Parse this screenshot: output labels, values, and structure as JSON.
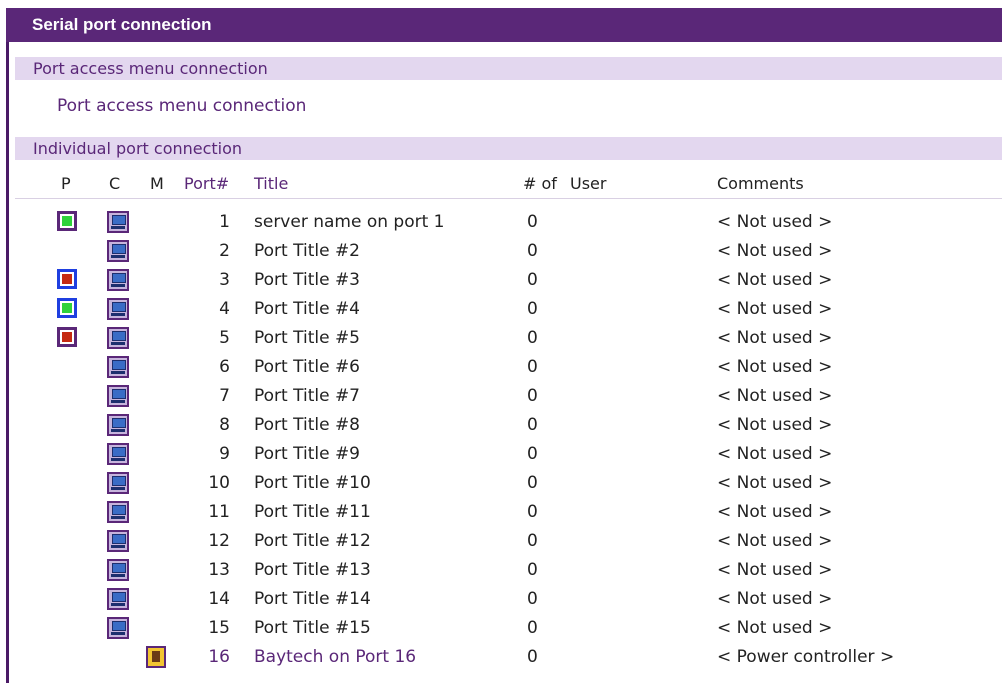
{
  "header": {
    "title": "Serial port connection"
  },
  "sections": {
    "menu": {
      "title": "Port access menu connection",
      "link": "Port access menu connection"
    },
    "individual": {
      "title": "Individual port connection"
    }
  },
  "columns": {
    "p": "P",
    "c": "C",
    "m": "M",
    "port": "Port#",
    "title": "Title",
    "count": "# of",
    "user": "User",
    "comments": "Comments"
  },
  "colors": {
    "accent": "#5a2778",
    "section_bg": "#e3d7ef",
    "power_on": "#2fd23b",
    "power_off": "#c52a12",
    "frame_purple": "#5a2778",
    "frame_blue": "#1f3fe0"
  },
  "ports": [
    {
      "port": "1",
      "title": "server name on port 1",
      "count": "0",
      "user": "",
      "comment": "< Not used >",
      "power": "on",
      "power_frame": "purple",
      "connect": true,
      "menu": false
    },
    {
      "port": "2",
      "title": "Port Title #2",
      "count": "0",
      "user": "",
      "comment": "< Not used >",
      "power": "",
      "power_frame": "",
      "connect": true,
      "menu": false
    },
    {
      "port": "3",
      "title": "Port Title #3",
      "count": "0",
      "user": "",
      "comment": "< Not used >",
      "power": "off",
      "power_frame": "blue",
      "connect": true,
      "menu": false
    },
    {
      "port": "4",
      "title": "Port Title #4",
      "count": "0",
      "user": "",
      "comment": "< Not used >",
      "power": "on",
      "power_frame": "blue",
      "connect": true,
      "menu": false
    },
    {
      "port": "5",
      "title": "Port Title #5",
      "count": "0",
      "user": "",
      "comment": "< Not used >",
      "power": "off",
      "power_frame": "purple",
      "connect": true,
      "menu": false
    },
    {
      "port": "6",
      "title": "Port Title #6",
      "count": "0",
      "user": "",
      "comment": "< Not used >",
      "power": "",
      "power_frame": "",
      "connect": true,
      "menu": false
    },
    {
      "port": "7",
      "title": "Port Title #7",
      "count": "0",
      "user": "",
      "comment": "< Not used >",
      "power": "",
      "power_frame": "",
      "connect": true,
      "menu": false
    },
    {
      "port": "8",
      "title": "Port Title #8",
      "count": "0",
      "user": "",
      "comment": "< Not used >",
      "power": "",
      "power_frame": "",
      "connect": true,
      "menu": false
    },
    {
      "port": "9",
      "title": "Port Title #9",
      "count": "0",
      "user": "",
      "comment": "< Not used >",
      "power": "",
      "power_frame": "",
      "connect": true,
      "menu": false
    },
    {
      "port": "10",
      "title": "Port Title #10",
      "count": "0",
      "user": "",
      "comment": "< Not used >",
      "power": "",
      "power_frame": "",
      "connect": true,
      "menu": false
    },
    {
      "port": "11",
      "title": "Port Title #11",
      "count": "0",
      "user": "",
      "comment": "< Not used >",
      "power": "",
      "power_frame": "",
      "connect": true,
      "menu": false
    },
    {
      "port": "12",
      "title": "Port Title #12",
      "count": "0",
      "user": "",
      "comment": "< Not used >",
      "power": "",
      "power_frame": "",
      "connect": true,
      "menu": false
    },
    {
      "port": "13",
      "title": "Port Title #13",
      "count": "0",
      "user": "",
      "comment": "< Not used >",
      "power": "",
      "power_frame": "",
      "connect": true,
      "menu": false
    },
    {
      "port": "14",
      "title": "Port Title #14",
      "count": "0",
      "user": "",
      "comment": "< Not used >",
      "power": "",
      "power_frame": "",
      "connect": true,
      "menu": false
    },
    {
      "port": "15",
      "title": "Port Title #15",
      "count": "0",
      "user": "",
      "comment": "< Not used >",
      "power": "",
      "power_frame": "",
      "connect": true,
      "menu": false
    },
    {
      "port": "16",
      "title": "Baytech on Port 16",
      "count": "0",
      "user": "",
      "comment": "< Power controller >",
      "power": "",
      "power_frame": "",
      "connect": false,
      "menu": true,
      "link": true
    }
  ]
}
